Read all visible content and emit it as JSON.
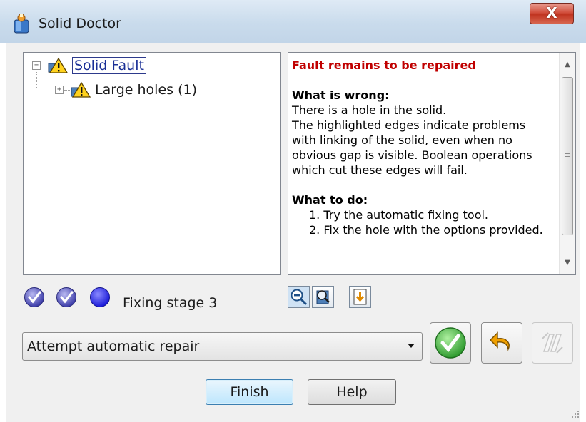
{
  "window": {
    "title": "Solid Doctor",
    "close_glyph": "X"
  },
  "tree": {
    "root": {
      "label": "Solid Fault",
      "expander": "−",
      "icon": "warning-icon"
    },
    "child": {
      "label": "Large holes (1)",
      "expander": "+",
      "icon": "warning-icon"
    }
  },
  "description": {
    "heading": "Fault remains to be repaired",
    "wrong_title": "What is wrong:",
    "wrong_lines": [
      "There is a hole in the solid.",
      "The highlighted edges indicate problems",
      "with linking of the solid, even when no",
      "obvious gap is visible. Boolean operations",
      "which cut these edges will fail."
    ],
    "todo_title": "What to do:",
    "todo_steps": [
      "1. Try the automatic fixing tool.",
      "2. Fix the hole with the options provided."
    ]
  },
  "stage": {
    "label": "Fixing stage 3",
    "indicators": [
      "checked",
      "checked",
      "current"
    ]
  },
  "tools": [
    "zoom-out-icon",
    "find-fault-icon",
    "export-icon"
  ],
  "repair": {
    "selected_option": "Attempt automatic repair"
  },
  "buttons": {
    "finish": "Finish",
    "help": "Help"
  },
  "colors": {
    "heading_red": "#c00000",
    "accent_blue": "#1a2f96",
    "apply_green": "#3cb23c"
  }
}
